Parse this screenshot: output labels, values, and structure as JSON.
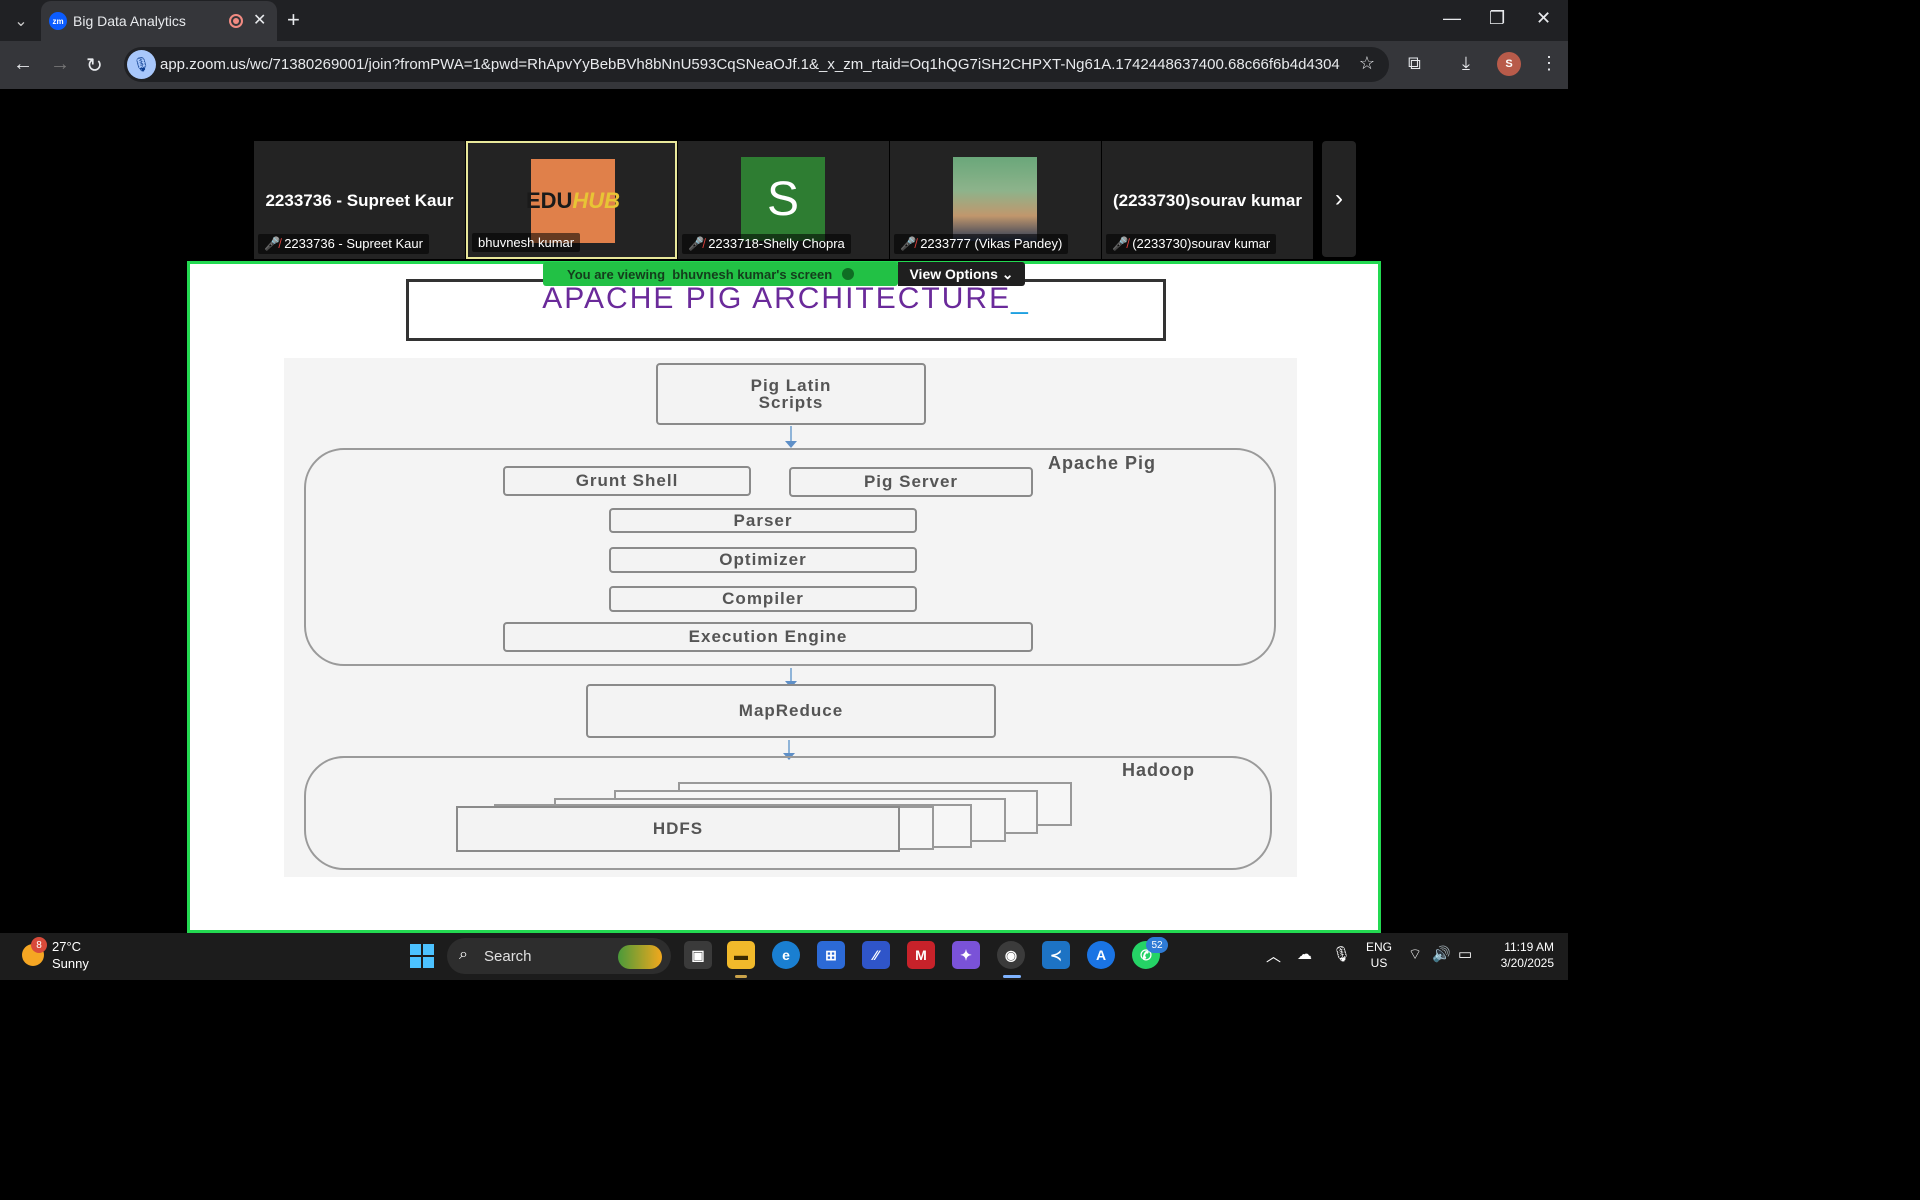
{
  "browser": {
    "tab_title": "Big Data Analytics",
    "tab_favicon": "zm",
    "url": "app.zoom.us/wc/71380269001/join?fromPWA=1&pwd=RhApvYyBebBVh8bNnU593CqSNeaOJf.1&_x_zm_rtaid=Oq1hQG7iSH2CHPXT-Ng61A.1742448637400.68c66f6b4d430470f42c90f3...",
    "profile_initial": "S"
  },
  "gallery": {
    "tiles": [
      {
        "display_name": "2233736 - Supreet Kaur",
        "label": "2233736 - Supreet Kaur",
        "muted": true,
        "avatar": "none"
      },
      {
        "display_name": "",
        "label": "bhuvnesh kumar",
        "muted": false,
        "avatar": "eduhub-logo"
      },
      {
        "display_name": "",
        "label": "2233718-Shelly Chopra",
        "muted": true,
        "avatar": "S"
      },
      {
        "display_name": "",
        "label": "2233777 (Vikas Pandey)",
        "muted": true,
        "avatar": "photo"
      },
      {
        "display_name": "(2233730)sourav kumar",
        "label": "(2233730)sourav kumar",
        "muted": true,
        "avatar": "none"
      }
    ],
    "eduhub": {
      "edu": "EDU",
      "hub": "HUB"
    },
    "s_avatar": "S"
  },
  "share": {
    "banner_prefix": "You are viewing",
    "banner_name": "bhuvnesh kumar's screen",
    "view_options": "View Options"
  },
  "slide": {
    "title": "APACHE PIG ARCHITECTURE",
    "diagram": {
      "scripts": "Pig Latin\nScripts",
      "apache_pig_label": "Apache Pig",
      "grunt_shell": "Grunt Shell",
      "pig_server": "Pig Server",
      "parser": "Parser",
      "optimizer": "Optimizer",
      "compiler": "Compiler",
      "execution_engine": "Execution Engine",
      "mapreduce": "MapReduce",
      "hadoop_label": "Hadoop",
      "hdfs": "HDFS"
    }
  },
  "taskbar": {
    "weather_badge": "8",
    "temperature": "27°C",
    "condition": "Sunny",
    "search_label": "Search",
    "whatsapp_badge": "52",
    "lang_line1": "ENG",
    "lang_line2": "US",
    "time": "11:19 AM",
    "date": "3/20/2025"
  },
  "colors": {
    "share_border": "#23d951",
    "banner_bg": "#22c145",
    "slide_title": "#6a2a9a",
    "active_tile_border": "#e8e79a"
  }
}
